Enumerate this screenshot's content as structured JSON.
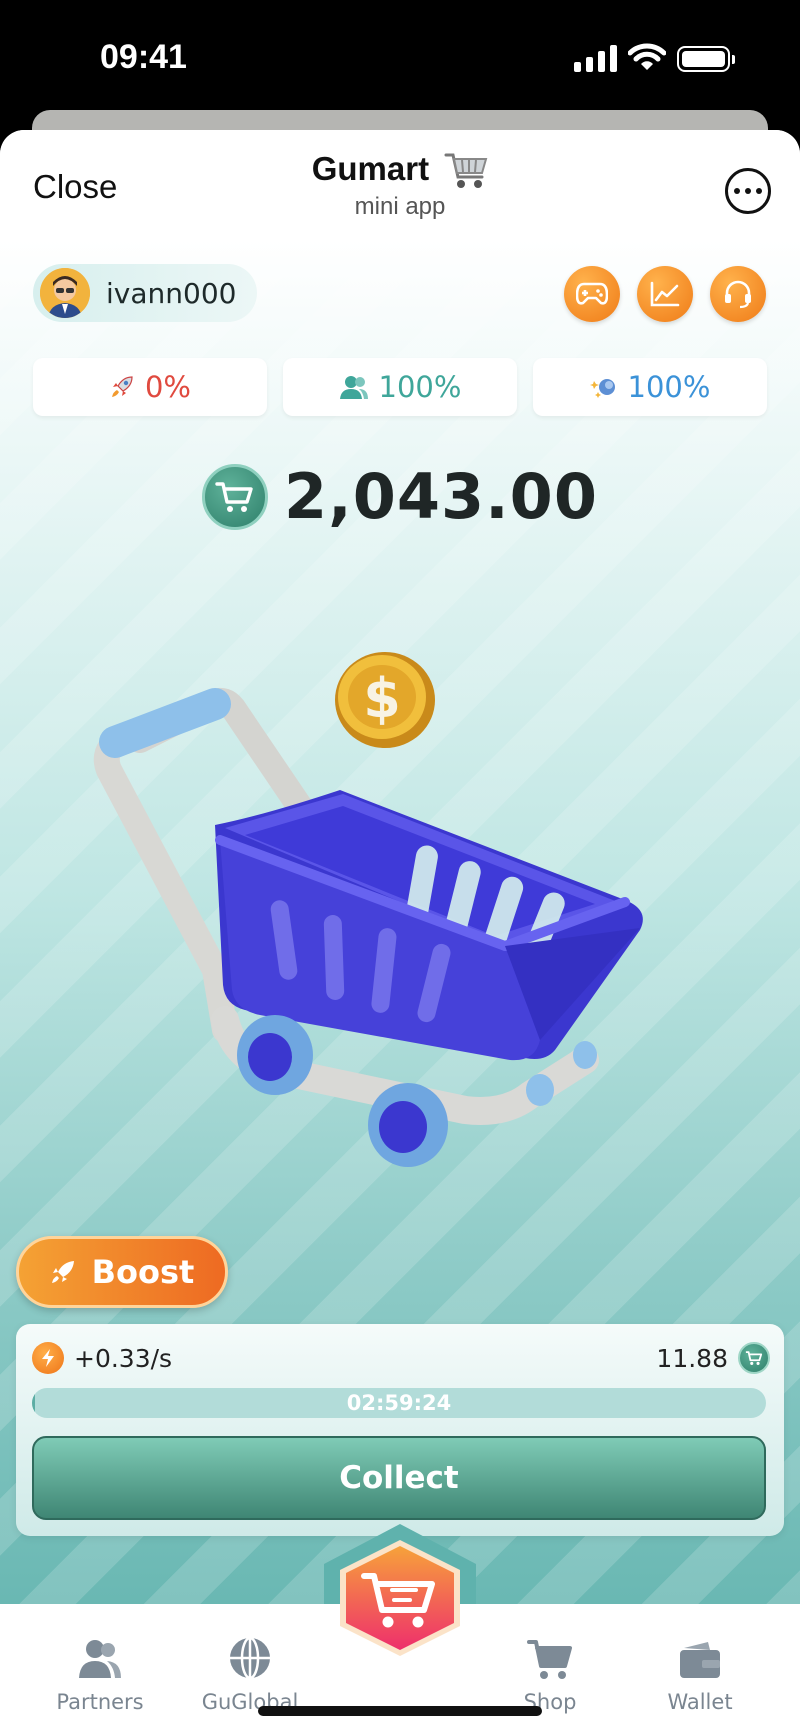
{
  "status_bar": {
    "time": "09:41"
  },
  "header": {
    "close_label": "Close",
    "title": "Gumart",
    "subtitle": "mini app"
  },
  "user": {
    "username": "ivann000"
  },
  "stats": [
    {
      "icon": "rocket-icon",
      "value": "0%",
      "color": "#e04a3f"
    },
    {
      "icon": "users-icon",
      "value": "100%",
      "color": "#3fa69a"
    },
    {
      "icon": "sparkle-icon",
      "value": "100%",
      "color": "#3b92d8"
    }
  ],
  "balance": {
    "value": "2,043.00"
  },
  "boost": {
    "label": "Boost"
  },
  "mining": {
    "rate": "+0.33/s",
    "earned": "11.88",
    "timer": "02:59:24",
    "progress": 0.004,
    "collect_label": "Collect"
  },
  "nav": {
    "partners": "Partners",
    "guglobal": "GuGlobal",
    "shop": "Shop",
    "wallet": "Wallet"
  },
  "colors": {
    "accent_orange": "#ef7b17",
    "accent_green": "#3f8674",
    "teal_bg": "#8ccac6"
  }
}
